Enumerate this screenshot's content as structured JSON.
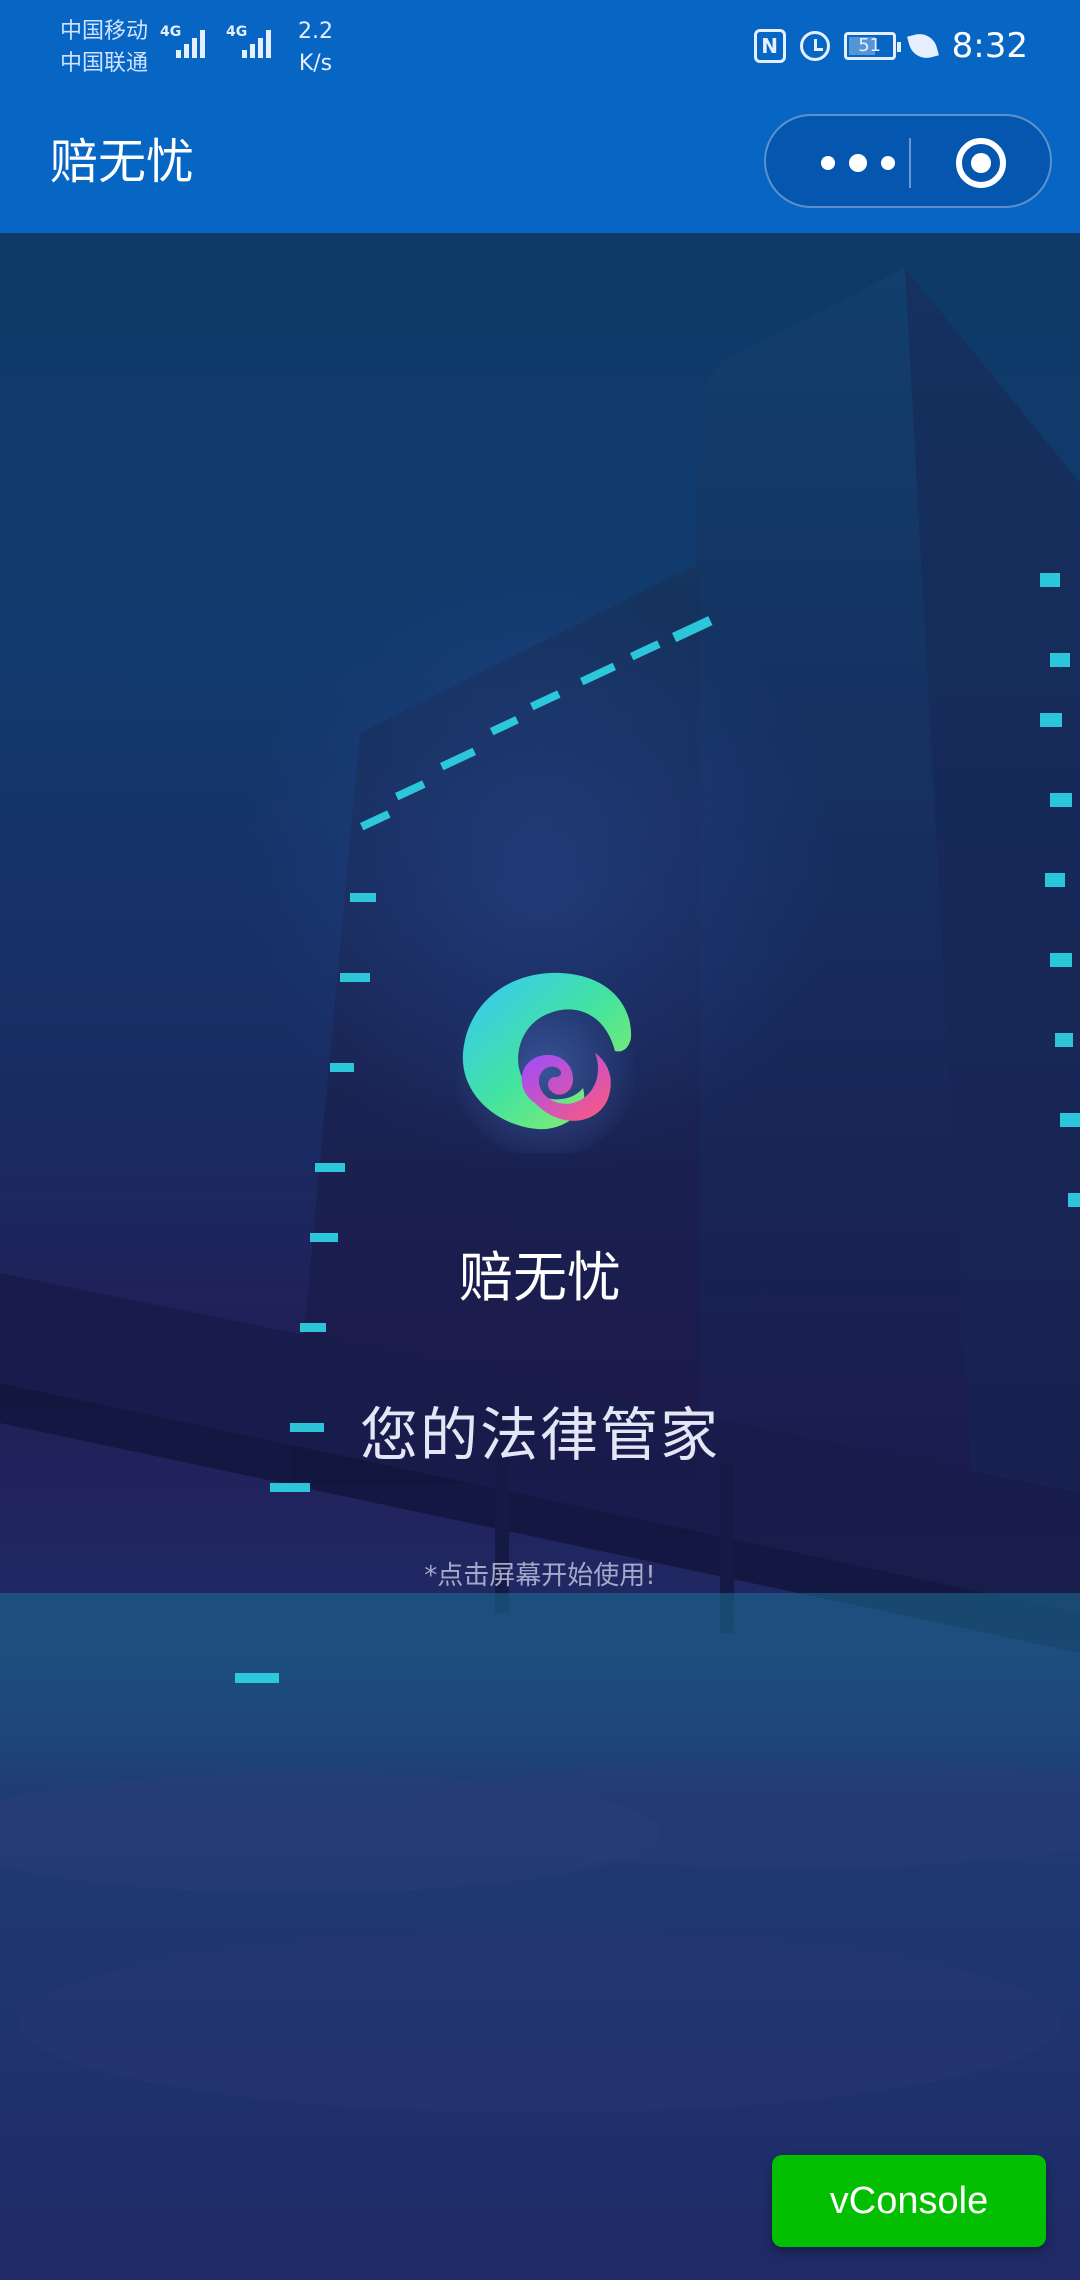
{
  "status_bar": {
    "carrier_1": "中国移动",
    "carrier_2": "中国联通",
    "network_1": "4G",
    "network_2": "4G",
    "speed_value": "2.2",
    "speed_unit": "K/s",
    "nfc_icon": "nfc-icon",
    "alarm_icon": "alarm-icon",
    "battery_level": "51",
    "leaf_icon": "eco-leaf-icon",
    "time": "8:32"
  },
  "nav": {
    "title": "赔无忧",
    "more_icon": "more-dots-icon",
    "close_icon": "close-target-icon"
  },
  "splash": {
    "app_name": "赔无忧",
    "tagline": "您的法律管家",
    "hint": "*点击屏幕开始使用!"
  },
  "debug": {
    "vconsole_label": "vConsole"
  },
  "colors": {
    "header_blue": "#0766c4",
    "vconsole_green": "#04be02",
    "window_glow": "#2fd7e8"
  }
}
